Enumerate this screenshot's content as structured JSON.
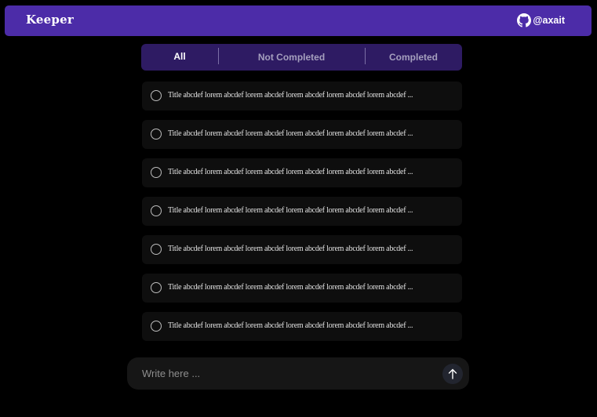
{
  "header": {
    "logo": "Keeper",
    "github_handle": "@axait",
    "github_icon": "github-icon"
  },
  "tabs": [
    {
      "label": "All",
      "active": true
    },
    {
      "label": "Not Completed",
      "active": false
    },
    {
      "label": "Completed",
      "active": false
    }
  ],
  "todos": [
    {
      "title": "Title abcdef lorem abcdef lorem abcdef lorem abcdef lorem abcdef lorem abcdef ...",
      "completed": false
    },
    {
      "title": "Title abcdef lorem abcdef lorem abcdef lorem abcdef lorem abcdef lorem abcdef ...",
      "completed": false
    },
    {
      "title": "Title abcdef lorem abcdef lorem abcdef lorem abcdef lorem abcdef lorem abcdef ...",
      "completed": false
    },
    {
      "title": "Title abcdef lorem abcdef lorem abcdef lorem abcdef lorem abcdef lorem abcdef ...",
      "completed": false
    },
    {
      "title": "Title abcdef lorem abcdef lorem abcdef lorem abcdef lorem abcdef lorem abcdef ...",
      "completed": false
    },
    {
      "title": "Title abcdef lorem abcdef lorem abcdef lorem abcdef lorem abcdef lorem abcdef ...",
      "completed": false
    },
    {
      "title": "Title abcdef lorem abcdef lorem abcdef lorem abcdef lorem abcdef lorem abcdef ...",
      "completed": false
    }
  ],
  "composer": {
    "placeholder": "Write here ...",
    "value": "",
    "send_icon": "arrow-up-icon"
  },
  "colors": {
    "navbar": "#4c2ca8",
    "tabs_bg": "#2e1b63",
    "background": "#000000",
    "item_bg": "#0e0e0e"
  }
}
